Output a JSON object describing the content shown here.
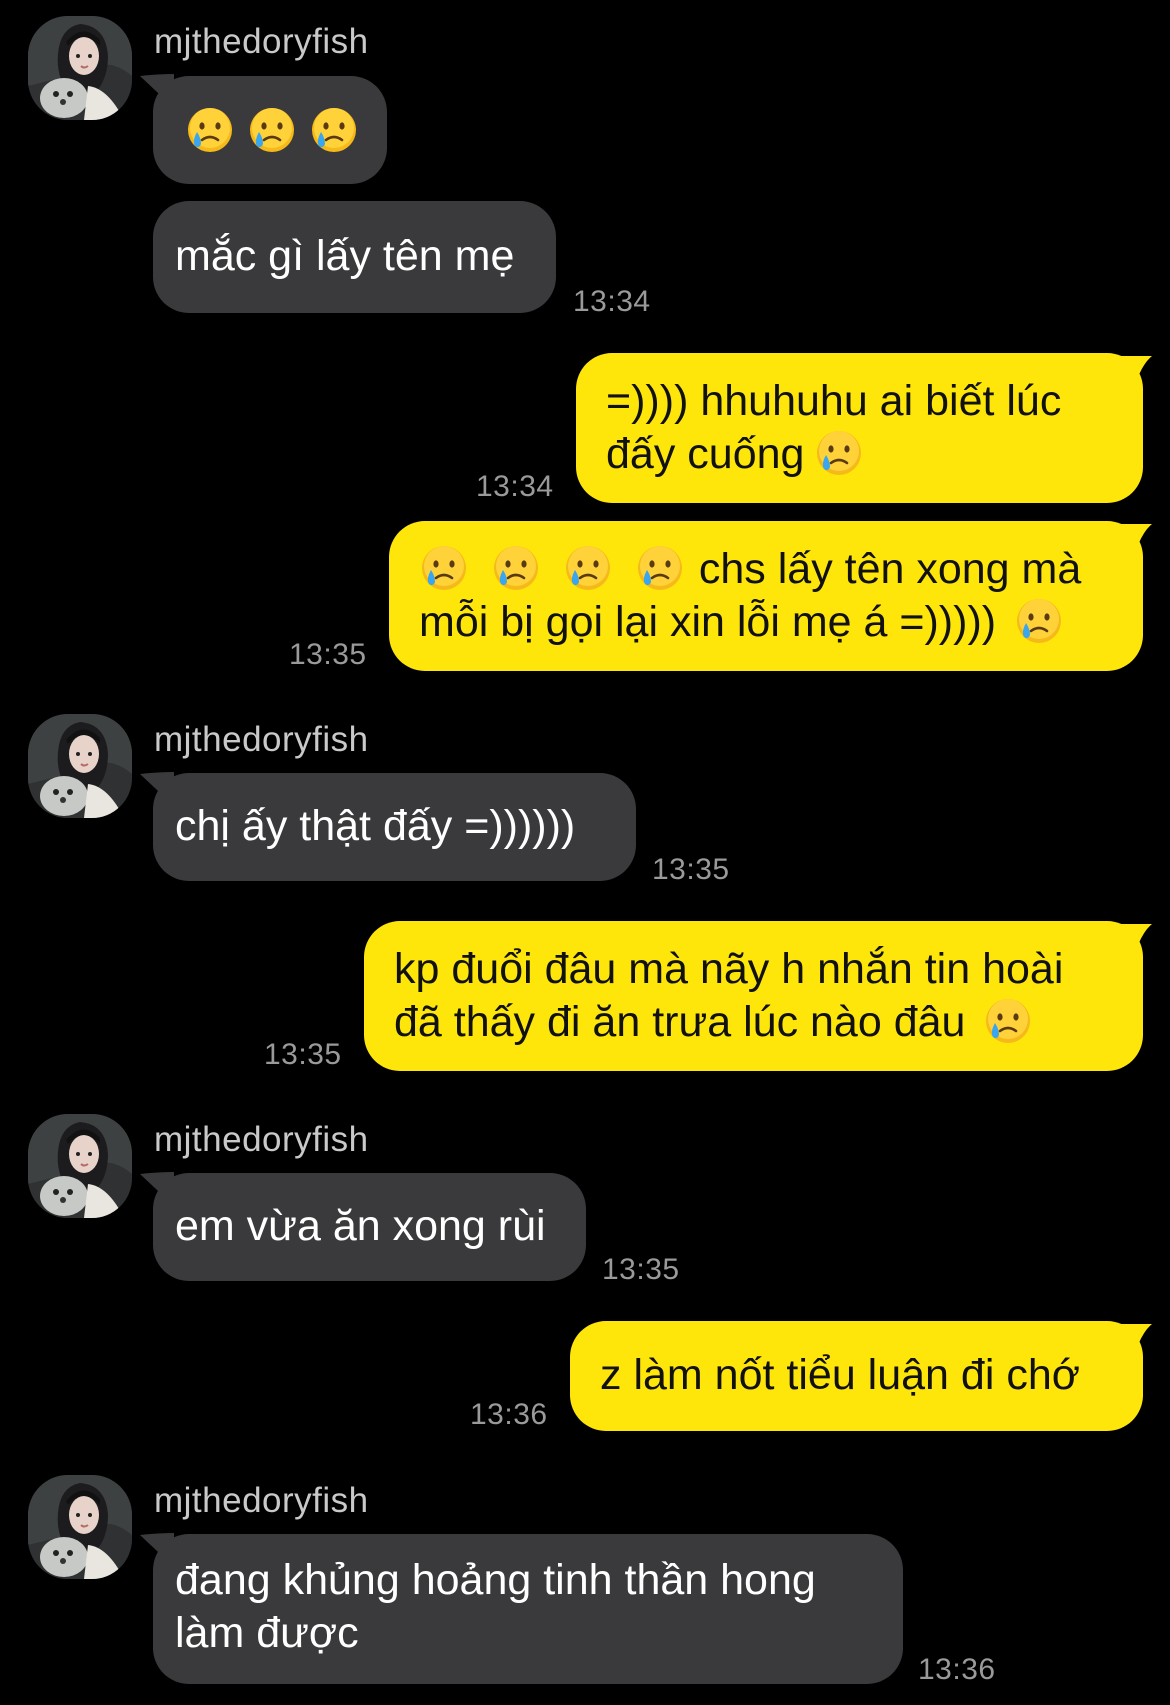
{
  "sender_name": "mjthedoryfish",
  "emoji_name": "crying-face-emoji",
  "colors": {
    "background": "#000000",
    "incoming_bubble": "#3a3a3c",
    "outgoing_bubble": "#ffe60a",
    "timestamp": "#9a9a9a"
  },
  "messages": [
    {
      "id": 1,
      "direction": "incoming",
      "show_sender": true,
      "emoji_only_count": 3,
      "text": ""
    },
    {
      "id": 2,
      "direction": "incoming",
      "show_sender": false,
      "text": "mắc gì lấy tên mẹ",
      "time": "13:34"
    },
    {
      "id": 3,
      "direction": "outgoing",
      "lines": [
        "=)))) hhuhuhu ai biết lúc",
        "đấy cuống"
      ],
      "time": "13:34"
    },
    {
      "id": 4,
      "direction": "outgoing",
      "lines": [
        "chs lấy tên xong mà",
        "mỗi bị gọi lại xin lỗi mẹ á =)))))"
      ],
      "time": "13:35"
    },
    {
      "id": 5,
      "direction": "incoming",
      "show_sender": true,
      "text": "chị ấy thật đấy =))))))",
      "time": "13:35"
    },
    {
      "id": 6,
      "direction": "outgoing",
      "lines": [
        "kp đuổi đâu mà nãy h nhắn tin hoài",
        "đã thấy đi ăn trưa lúc nào đâu"
      ],
      "time": "13:35"
    },
    {
      "id": 7,
      "direction": "incoming",
      "show_sender": true,
      "text": "em vừa ăn xong rùi",
      "time": "13:35"
    },
    {
      "id": 8,
      "direction": "outgoing",
      "text": "z làm nốt tiểu luận đi chớ",
      "time": "13:36"
    },
    {
      "id": 9,
      "direction": "incoming",
      "show_sender": true,
      "lines": [
        "đang khủng hoảng tinh thần hong",
        "làm được"
      ],
      "time": "13:36"
    }
  ]
}
